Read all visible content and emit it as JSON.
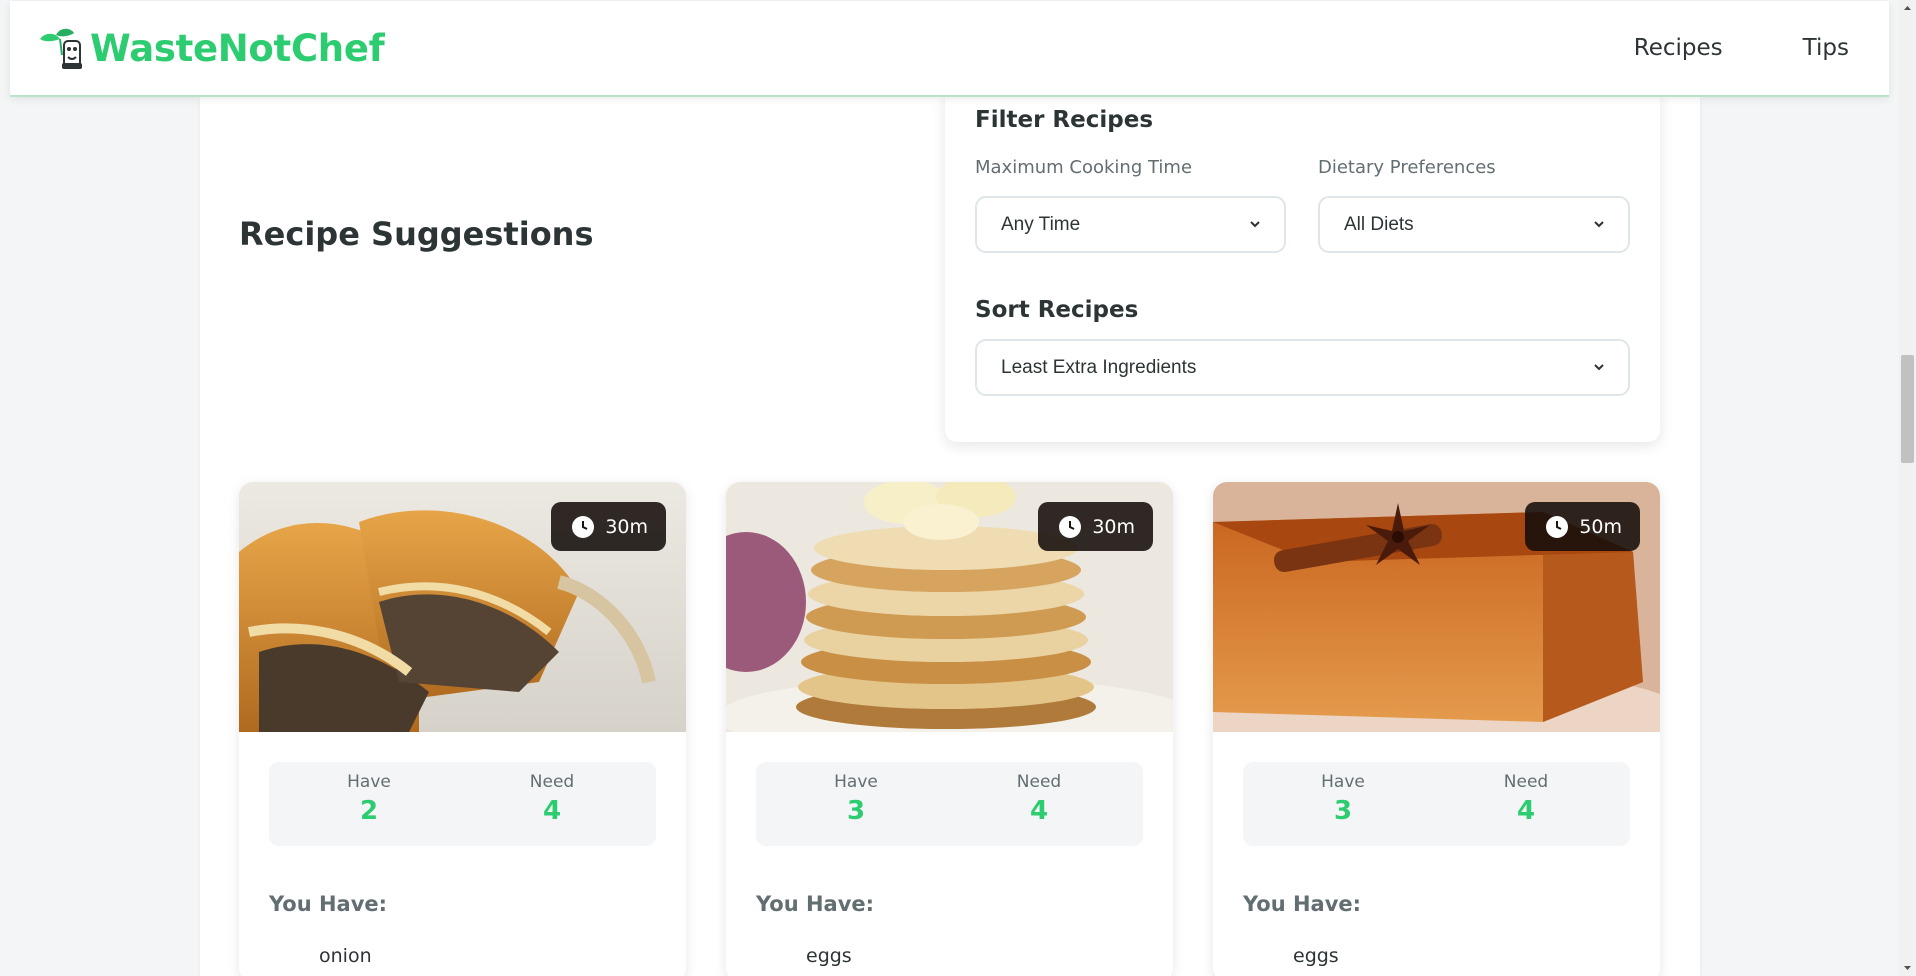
{
  "header": {
    "brand": "WasteNotChef",
    "nav": [
      {
        "label": "Recipes"
      },
      {
        "label": "Tips"
      }
    ]
  },
  "main": {
    "title": "Recipe Suggestions"
  },
  "filters": {
    "title": "Filter Recipes",
    "cooking_time": {
      "label": "Maximum Cooking Time",
      "value": "Any Time"
    },
    "diet": {
      "label": "Dietary Preferences",
      "value": "All Diets"
    },
    "sort": {
      "title": "Sort Recipes",
      "value": "Least Extra Ingredients"
    }
  },
  "cards": [
    {
      "time": "30m",
      "have_label": "Have",
      "have": "2",
      "need_label": "Need",
      "need": "4",
      "you_have_title": "You Have:",
      "first_item": "onion",
      "image": "meat-pie-photo"
    },
    {
      "time": "30m",
      "have_label": "Have",
      "have": "3",
      "need_label": "Need",
      "need": "4",
      "you_have_title": "You Have:",
      "first_item": "eggs",
      "image": "banana-pancakes-photo"
    },
    {
      "time": "50m",
      "have_label": "Have",
      "have": "3",
      "need_label": "Need",
      "need": "4",
      "you_have_title": "You Have:",
      "first_item": "eggs",
      "image": "spiced-cake-photo"
    }
  ],
  "colors": {
    "accent": "#2ecc71",
    "text": "#2d3436",
    "muted": "#636e72",
    "page_bg": "#f3f5f6"
  }
}
